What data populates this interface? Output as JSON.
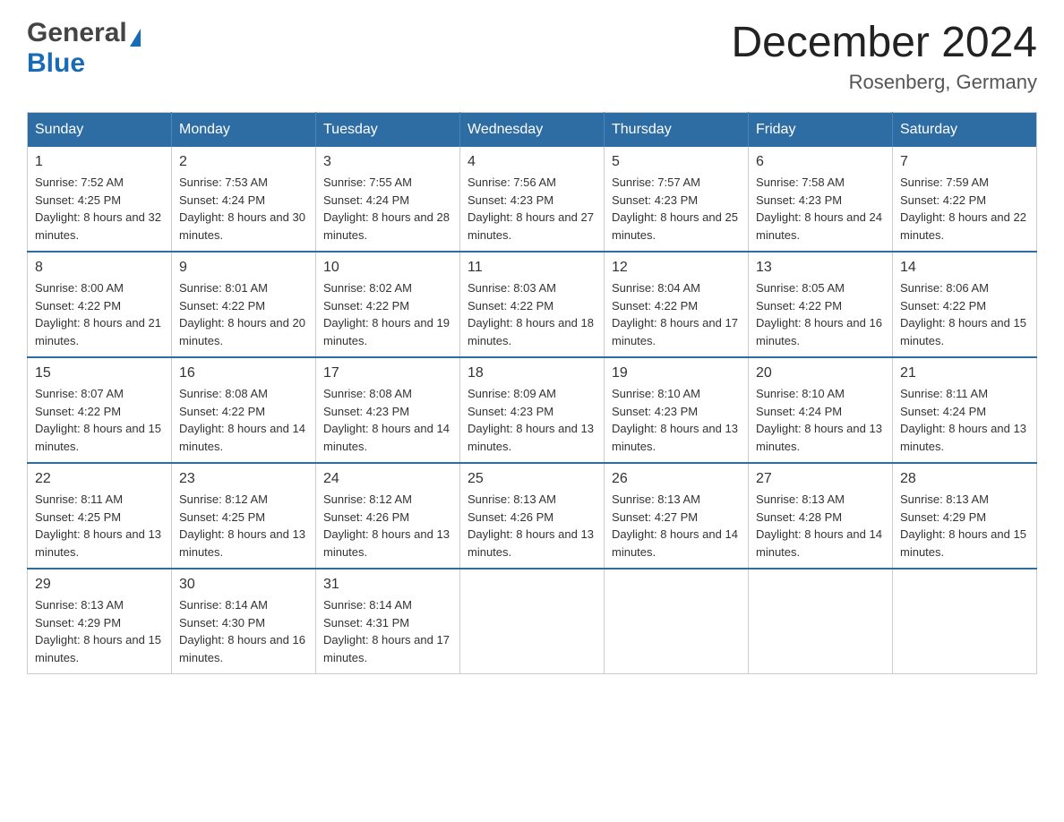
{
  "logo": {
    "general": "General",
    "blue": "Blue"
  },
  "title": "December 2024",
  "location": "Rosenberg, Germany",
  "days_of_week": [
    "Sunday",
    "Monday",
    "Tuesday",
    "Wednesday",
    "Thursday",
    "Friday",
    "Saturday"
  ],
  "weeks": [
    [
      {
        "day": "1",
        "sunrise": "Sunrise: 7:52 AM",
        "sunset": "Sunset: 4:25 PM",
        "daylight": "Daylight: 8 hours and 32 minutes."
      },
      {
        "day": "2",
        "sunrise": "Sunrise: 7:53 AM",
        "sunset": "Sunset: 4:24 PM",
        "daylight": "Daylight: 8 hours and 30 minutes."
      },
      {
        "day": "3",
        "sunrise": "Sunrise: 7:55 AM",
        "sunset": "Sunset: 4:24 PM",
        "daylight": "Daylight: 8 hours and 28 minutes."
      },
      {
        "day": "4",
        "sunrise": "Sunrise: 7:56 AM",
        "sunset": "Sunset: 4:23 PM",
        "daylight": "Daylight: 8 hours and 27 minutes."
      },
      {
        "day": "5",
        "sunrise": "Sunrise: 7:57 AM",
        "sunset": "Sunset: 4:23 PM",
        "daylight": "Daylight: 8 hours and 25 minutes."
      },
      {
        "day": "6",
        "sunrise": "Sunrise: 7:58 AM",
        "sunset": "Sunset: 4:23 PM",
        "daylight": "Daylight: 8 hours and 24 minutes."
      },
      {
        "day": "7",
        "sunrise": "Sunrise: 7:59 AM",
        "sunset": "Sunset: 4:22 PM",
        "daylight": "Daylight: 8 hours and 22 minutes."
      }
    ],
    [
      {
        "day": "8",
        "sunrise": "Sunrise: 8:00 AM",
        "sunset": "Sunset: 4:22 PM",
        "daylight": "Daylight: 8 hours and 21 minutes."
      },
      {
        "day": "9",
        "sunrise": "Sunrise: 8:01 AM",
        "sunset": "Sunset: 4:22 PM",
        "daylight": "Daylight: 8 hours and 20 minutes."
      },
      {
        "day": "10",
        "sunrise": "Sunrise: 8:02 AM",
        "sunset": "Sunset: 4:22 PM",
        "daylight": "Daylight: 8 hours and 19 minutes."
      },
      {
        "day": "11",
        "sunrise": "Sunrise: 8:03 AM",
        "sunset": "Sunset: 4:22 PM",
        "daylight": "Daylight: 8 hours and 18 minutes."
      },
      {
        "day": "12",
        "sunrise": "Sunrise: 8:04 AM",
        "sunset": "Sunset: 4:22 PM",
        "daylight": "Daylight: 8 hours and 17 minutes."
      },
      {
        "day": "13",
        "sunrise": "Sunrise: 8:05 AM",
        "sunset": "Sunset: 4:22 PM",
        "daylight": "Daylight: 8 hours and 16 minutes."
      },
      {
        "day": "14",
        "sunrise": "Sunrise: 8:06 AM",
        "sunset": "Sunset: 4:22 PM",
        "daylight": "Daylight: 8 hours and 15 minutes."
      }
    ],
    [
      {
        "day": "15",
        "sunrise": "Sunrise: 8:07 AM",
        "sunset": "Sunset: 4:22 PM",
        "daylight": "Daylight: 8 hours and 15 minutes."
      },
      {
        "day": "16",
        "sunrise": "Sunrise: 8:08 AM",
        "sunset": "Sunset: 4:22 PM",
        "daylight": "Daylight: 8 hours and 14 minutes."
      },
      {
        "day": "17",
        "sunrise": "Sunrise: 8:08 AM",
        "sunset": "Sunset: 4:23 PM",
        "daylight": "Daylight: 8 hours and 14 minutes."
      },
      {
        "day": "18",
        "sunrise": "Sunrise: 8:09 AM",
        "sunset": "Sunset: 4:23 PM",
        "daylight": "Daylight: 8 hours and 13 minutes."
      },
      {
        "day": "19",
        "sunrise": "Sunrise: 8:10 AM",
        "sunset": "Sunset: 4:23 PM",
        "daylight": "Daylight: 8 hours and 13 minutes."
      },
      {
        "day": "20",
        "sunrise": "Sunrise: 8:10 AM",
        "sunset": "Sunset: 4:24 PM",
        "daylight": "Daylight: 8 hours and 13 minutes."
      },
      {
        "day": "21",
        "sunrise": "Sunrise: 8:11 AM",
        "sunset": "Sunset: 4:24 PM",
        "daylight": "Daylight: 8 hours and 13 minutes."
      }
    ],
    [
      {
        "day": "22",
        "sunrise": "Sunrise: 8:11 AM",
        "sunset": "Sunset: 4:25 PM",
        "daylight": "Daylight: 8 hours and 13 minutes."
      },
      {
        "day": "23",
        "sunrise": "Sunrise: 8:12 AM",
        "sunset": "Sunset: 4:25 PM",
        "daylight": "Daylight: 8 hours and 13 minutes."
      },
      {
        "day": "24",
        "sunrise": "Sunrise: 8:12 AM",
        "sunset": "Sunset: 4:26 PM",
        "daylight": "Daylight: 8 hours and 13 minutes."
      },
      {
        "day": "25",
        "sunrise": "Sunrise: 8:13 AM",
        "sunset": "Sunset: 4:26 PM",
        "daylight": "Daylight: 8 hours and 13 minutes."
      },
      {
        "day": "26",
        "sunrise": "Sunrise: 8:13 AM",
        "sunset": "Sunset: 4:27 PM",
        "daylight": "Daylight: 8 hours and 14 minutes."
      },
      {
        "day": "27",
        "sunrise": "Sunrise: 8:13 AM",
        "sunset": "Sunset: 4:28 PM",
        "daylight": "Daylight: 8 hours and 14 minutes."
      },
      {
        "day": "28",
        "sunrise": "Sunrise: 8:13 AM",
        "sunset": "Sunset: 4:29 PM",
        "daylight": "Daylight: 8 hours and 15 minutes."
      }
    ],
    [
      {
        "day": "29",
        "sunrise": "Sunrise: 8:13 AM",
        "sunset": "Sunset: 4:29 PM",
        "daylight": "Daylight: 8 hours and 15 minutes."
      },
      {
        "day": "30",
        "sunrise": "Sunrise: 8:14 AM",
        "sunset": "Sunset: 4:30 PM",
        "daylight": "Daylight: 8 hours and 16 minutes."
      },
      {
        "day": "31",
        "sunrise": "Sunrise: 8:14 AM",
        "sunset": "Sunset: 4:31 PM",
        "daylight": "Daylight: 8 hours and 17 minutes."
      },
      null,
      null,
      null,
      null
    ]
  ]
}
